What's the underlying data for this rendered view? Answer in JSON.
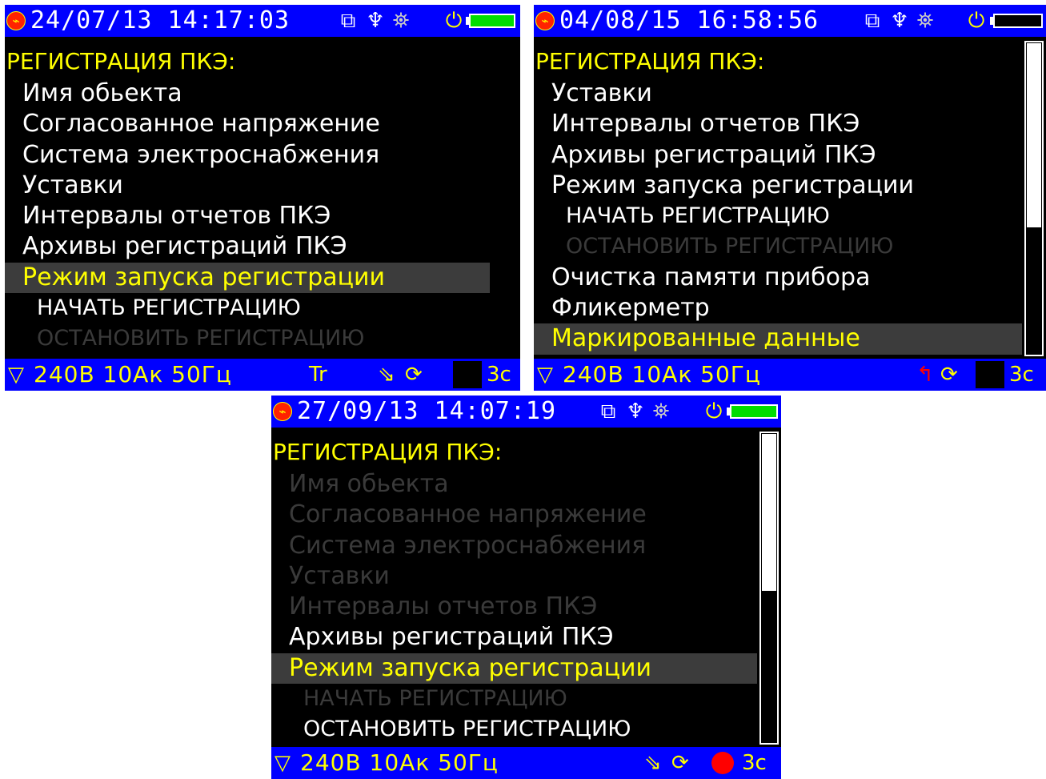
{
  "screens": [
    {
      "datetime": "24/07/13 14:17:03",
      "title": "РЕГИСТРАЦИЯ ПКЭ:",
      "items": [
        {
          "label": "Имя обьекта"
        },
        {
          "label": "Согласованное напряжение"
        },
        {
          "label": "Система электроснабжения"
        },
        {
          "label": "Уставки"
        },
        {
          "label": "Интервалы отчетов ПКЭ"
        },
        {
          "label": "Архивы регистраций ПКЭ"
        },
        {
          "label": "Режим запуска регистрации"
        },
        {
          "label": "НАЧАТЬ РЕГИСТРАЦИЮ"
        },
        {
          "label": "ОСТАНОВИТЬ РЕГИСТРАЦИЮ"
        }
      ],
      "status": {
        "params": "240В 10Ак 50Гц",
        "trigger": "Tr",
        "interval": "3с"
      },
      "battery": "full"
    },
    {
      "datetime": "04/08/15 16:58:56",
      "title": "РЕГИСТРАЦИЯ ПКЭ:",
      "items": [
        {
          "label": "Уставки"
        },
        {
          "label": "Интервалы отчетов ПКЭ"
        },
        {
          "label": "Архивы регистраций ПКЭ"
        },
        {
          "label": "Режим запуска регистрации"
        },
        {
          "label": "НАЧАТЬ РЕГИСТРАЦИЮ"
        },
        {
          "label": "ОСТАНОВИТЬ РЕГИСТРАЦИЮ"
        },
        {
          "label": "Очистка памяти прибора"
        },
        {
          "label": "Фликерметр"
        },
        {
          "label": "Маркированные данные"
        }
      ],
      "status": {
        "params": "240В 10Ак 50Гц",
        "interval": "3с"
      },
      "battery": "empty"
    },
    {
      "datetime": "27/09/13 14:07:19",
      "title": "РЕГИСТРАЦИЯ ПКЭ:",
      "items": [
        {
          "label": "Имя обьекта"
        },
        {
          "label": "Согласованное напряжение"
        },
        {
          "label": "Система электроснабжения"
        },
        {
          "label": "Уставки"
        },
        {
          "label": "Интервалы отчетов ПКЭ"
        },
        {
          "label": "Архивы регистраций ПКЭ"
        },
        {
          "label": "Режим запуска регистрации"
        },
        {
          "label": "НАЧАТЬ РЕГИСТРАЦИЮ"
        },
        {
          "label": "ОСТАНОВИТЬ РЕГИСТРАЦИЮ"
        }
      ],
      "status": {
        "params": "240В 10Ак 50Гц",
        "interval": "3с"
      },
      "battery": "full",
      "recording": true
    }
  ],
  "colors": {
    "bar": "#0000ff",
    "title": "#ffff00",
    "selected_bg": "#3c3c3c",
    "disabled": "#3a3a3a",
    "record": "#ff0000"
  },
  "icons": [
    "logo-icon",
    "pc-link-icon",
    "usb-icon",
    "gps-icon",
    "power-plug-icon",
    "battery-icon",
    "phase-triangle-icon",
    "phase-rotation-icon",
    "refresh-icon",
    "recording-dot-icon"
  ]
}
